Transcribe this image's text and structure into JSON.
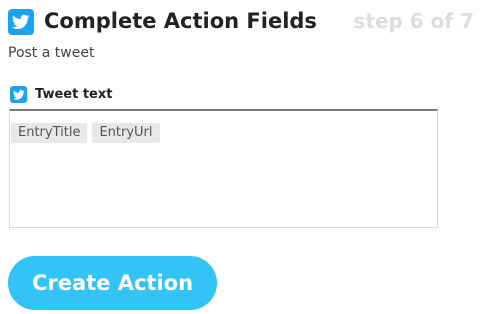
{
  "header": {
    "title": "Complete Action Fields",
    "step": "step 6 of 7",
    "service_icon": "twitter-icon"
  },
  "subtitle": "Post a tweet",
  "field": {
    "label": "Tweet text",
    "icon": "twitter-icon",
    "tokens": [
      "EntryTitle",
      "EntryUrl"
    ]
  },
  "actions": {
    "create_label": "Create Action"
  },
  "colors": {
    "twitter_blue": "#1da1f2",
    "button_blue": "#33c4f5",
    "step_gray": "#dddddd"
  }
}
